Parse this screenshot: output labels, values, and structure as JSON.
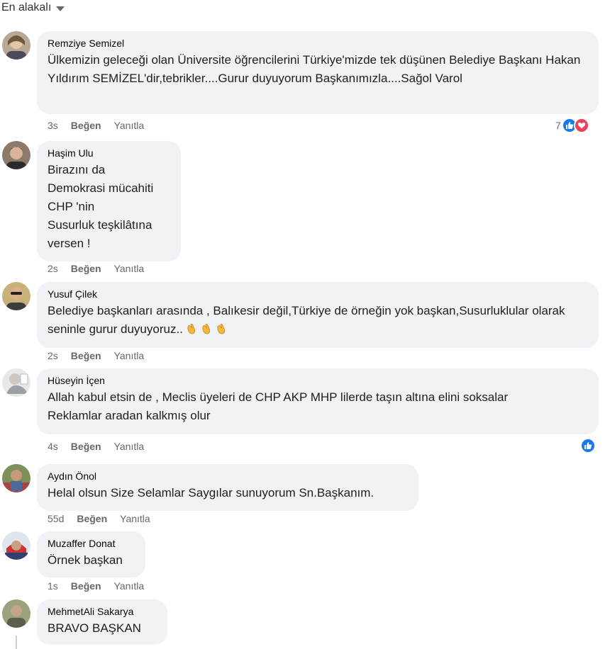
{
  "sort": {
    "label": "En alakalı"
  },
  "actions": {
    "like": "Beğen",
    "reply": "Yanıtla"
  },
  "comments": [
    {
      "author": "Remziye Semizel",
      "text": "Ülkemizin geleceği olan Üniversite öğrencilerini Türkiye'mizde tek düşünen Belediye Başkanı Hakan Yıldırım SEMİZEL'dir,tebrikler....Gurur duyuyorum Başkanımızla....Sağol Varol",
      "time": "3s",
      "reactions": {
        "count": "7",
        "types": [
          "like",
          "love"
        ]
      }
    },
    {
      "author": "Haşim Ulu",
      "text": "Birazını da\nDemokrasi mücahiti\nCHP 'nin\nSusurluk teşkilâtına\nversen !",
      "time": "2s"
    },
    {
      "author": "Yusuf Çilek",
      "text": "Belediye başkanları arasında , Balıkesir değil,Türkiye de örneğin yok başkan,Susurluklular olarak seninle gurur duyuyoruz..",
      "emoji": [
        "clapping-hands",
        "clapping-hands",
        "clapping-hands"
      ],
      "time": "2s"
    },
    {
      "author": "Hüseyin İçen",
      "text": "Allah kabul etsin de , Meclis üyeleri de CHP AKP MHP lilerde taşın altına elini soksalar\nReklamlar aradan kalkmış olur",
      "time": "4s",
      "reactions": {
        "count": "",
        "types": [
          "like"
        ]
      }
    },
    {
      "author": "Aydın Önol",
      "text": "Helal olsun Size Selamlar Saygılar sunuyorum Sn.Başkanım.",
      "time": "55d"
    },
    {
      "author": "Muzaffer Donat",
      "text": "Örnek başkan",
      "time": "1s"
    },
    {
      "author": "MehmetAli Sakarya",
      "text": "BRAVO BAŞKAN"
    }
  ],
  "colors": {
    "bubble": "#f0f2f5",
    "like_blue": "#1877f2",
    "love_red": "#f33e58",
    "meta_gray": "#65676b"
  }
}
